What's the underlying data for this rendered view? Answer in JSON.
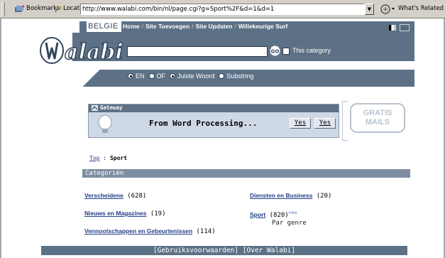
{
  "browser": {
    "bookmarks_label": "Bookmarks",
    "location_label": "Location:",
    "url": "http://www.walabi.com/bin/nl/page.cgi?g=Sport%2F&d=1&d=1",
    "related_label": "What's Related"
  },
  "header": {
    "region": "BELGIE",
    "links": [
      "Home",
      "Site Toevoegen",
      "Site Updaten",
      "Willekeurige Surf"
    ],
    "logo_text": "Walabi",
    "go_label": "GO",
    "category_checkbox_label": "This category",
    "search_options": [
      {
        "label": "EN",
        "selected": true
      },
      {
        "label": "OF",
        "selected": false
      },
      {
        "label": "Juiste Woord",
        "selected": true
      },
      {
        "label": "Substring",
        "selected": false
      }
    ]
  },
  "gateway": {
    "title": "Gateway",
    "message": "From Word Processing...",
    "buttons": [
      "Yes",
      "Yes"
    ],
    "side_ad": [
      "GRATIS",
      "MAILS"
    ]
  },
  "breadcrumb": {
    "top": "Top",
    "separator": ":",
    "current": "Sport"
  },
  "categories": {
    "heading": "Categoriën",
    "left": [
      {
        "name": "Verscheidene",
        "count": "(628)"
      },
      {
        "name": "Nieuws en Magazines",
        "count": "(19)"
      },
      {
        "name": "Vennootschappen en Gebeurtenissen",
        "count": "(114)"
      }
    ],
    "right": [
      {
        "name": "Diensten en Business",
        "count": "(20)"
      },
      {
        "name": "Sport",
        "count": "(820)",
        "badge": "new",
        "sub": "Par genre"
      }
    ]
  },
  "footer": {
    "links": [
      "[Gebruiksvoorwaarden]",
      "[Over Walabi]"
    ]
  },
  "colors": {
    "header": "#5d7186",
    "link": "#233f87",
    "category_bar": "#7d8ea2",
    "panel": "#cfd9e6"
  }
}
